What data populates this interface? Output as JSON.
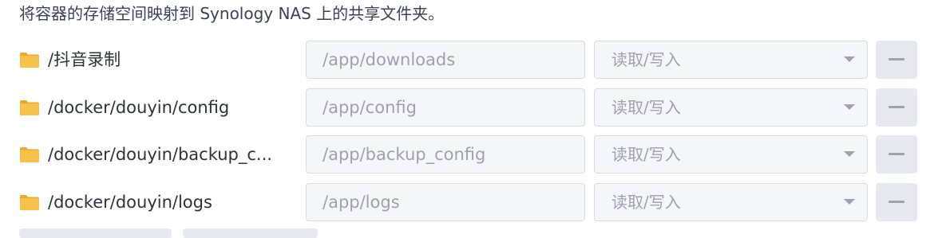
{
  "description": "将容器的存储空间映射到 Synology NAS 上的共享文件夹。",
  "mappings": [
    {
      "icon": "folder-icon",
      "path": "/抖音录制",
      "mount_placeholder": "/app/downloads",
      "permission": "读取/写入",
      "remove_icon": "minus-icon"
    },
    {
      "icon": "folder-icon",
      "path": "/docker/douyin/config",
      "mount_placeholder": "/app/config",
      "permission": "读取/写入",
      "remove_icon": "minus-icon"
    },
    {
      "icon": "folder-icon",
      "path": "/docker/douyin/backup_c...",
      "mount_placeholder": "/app/backup_config",
      "permission": "读取/写入",
      "remove_icon": "minus-icon"
    },
    {
      "icon": "folder-icon",
      "path": "/docker/douyin/logs",
      "mount_placeholder": "/app/logs",
      "permission": "读取/写入",
      "remove_icon": "minus-icon"
    }
  ],
  "colors": {
    "folder": "#f7c14a",
    "field_bg": "#f4f6f9",
    "field_border": "#d7dde6",
    "placeholder": "#9aa3af",
    "button_bg": "#e6eaf0"
  }
}
